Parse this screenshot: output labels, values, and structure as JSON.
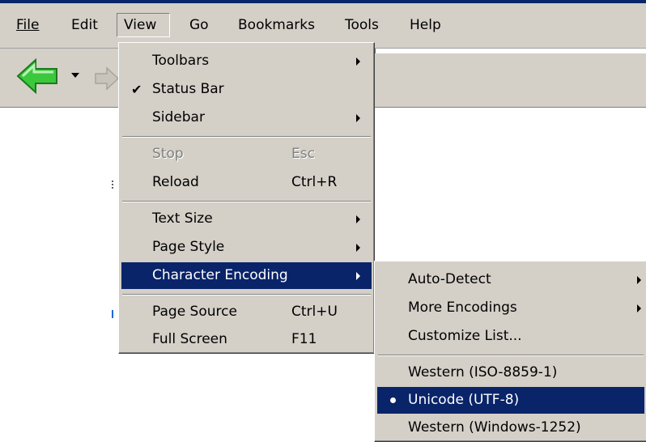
{
  "menubar": {
    "items": [
      {
        "label": "File"
      },
      {
        "label": "Edit"
      },
      {
        "label": "View"
      },
      {
        "label": "Go"
      },
      {
        "label": "Bookmarks"
      },
      {
        "label": "Tools"
      },
      {
        "label": "Help"
      }
    ]
  },
  "view_menu": {
    "toolbars": {
      "label": "Toolbars"
    },
    "status_bar": {
      "label": "Status Bar",
      "checked": true
    },
    "sidebar": {
      "label": "Sidebar"
    },
    "stop": {
      "label": "Stop",
      "shortcut": "Esc"
    },
    "reload": {
      "label": "Reload",
      "shortcut": "Ctrl+R"
    },
    "text_size": {
      "label": "Text Size"
    },
    "page_style": {
      "label": "Page Style"
    },
    "character_encoding": {
      "label": "Character Encoding"
    },
    "page_source": {
      "label": "Page Source",
      "shortcut": "Ctrl+U"
    },
    "full_screen": {
      "label": "Full Screen",
      "shortcut": "F11"
    }
  },
  "encoding_menu": {
    "auto_detect": {
      "label": "Auto-Detect"
    },
    "more_encodings": {
      "label": "More Encodings"
    },
    "customize_list": {
      "label": "Customize List..."
    },
    "western_iso": {
      "label": "Western (ISO-8859-1)"
    },
    "unicode_utf8": {
      "label": "Unicode (UTF-8)",
      "selected": true
    },
    "western_windows": {
      "label": "Western (Windows-1252)"
    }
  },
  "colors": {
    "menu_bg": "#d4d0c8",
    "highlight": "#0a246a",
    "back_arrow": "#3cc83c"
  },
  "icons": [
    "back-arrow-icon",
    "dropdown-icon",
    "forward-arrow-icon",
    "checkmark-icon",
    "submenu-arrow-icon",
    "radio-bullet-icon"
  ]
}
